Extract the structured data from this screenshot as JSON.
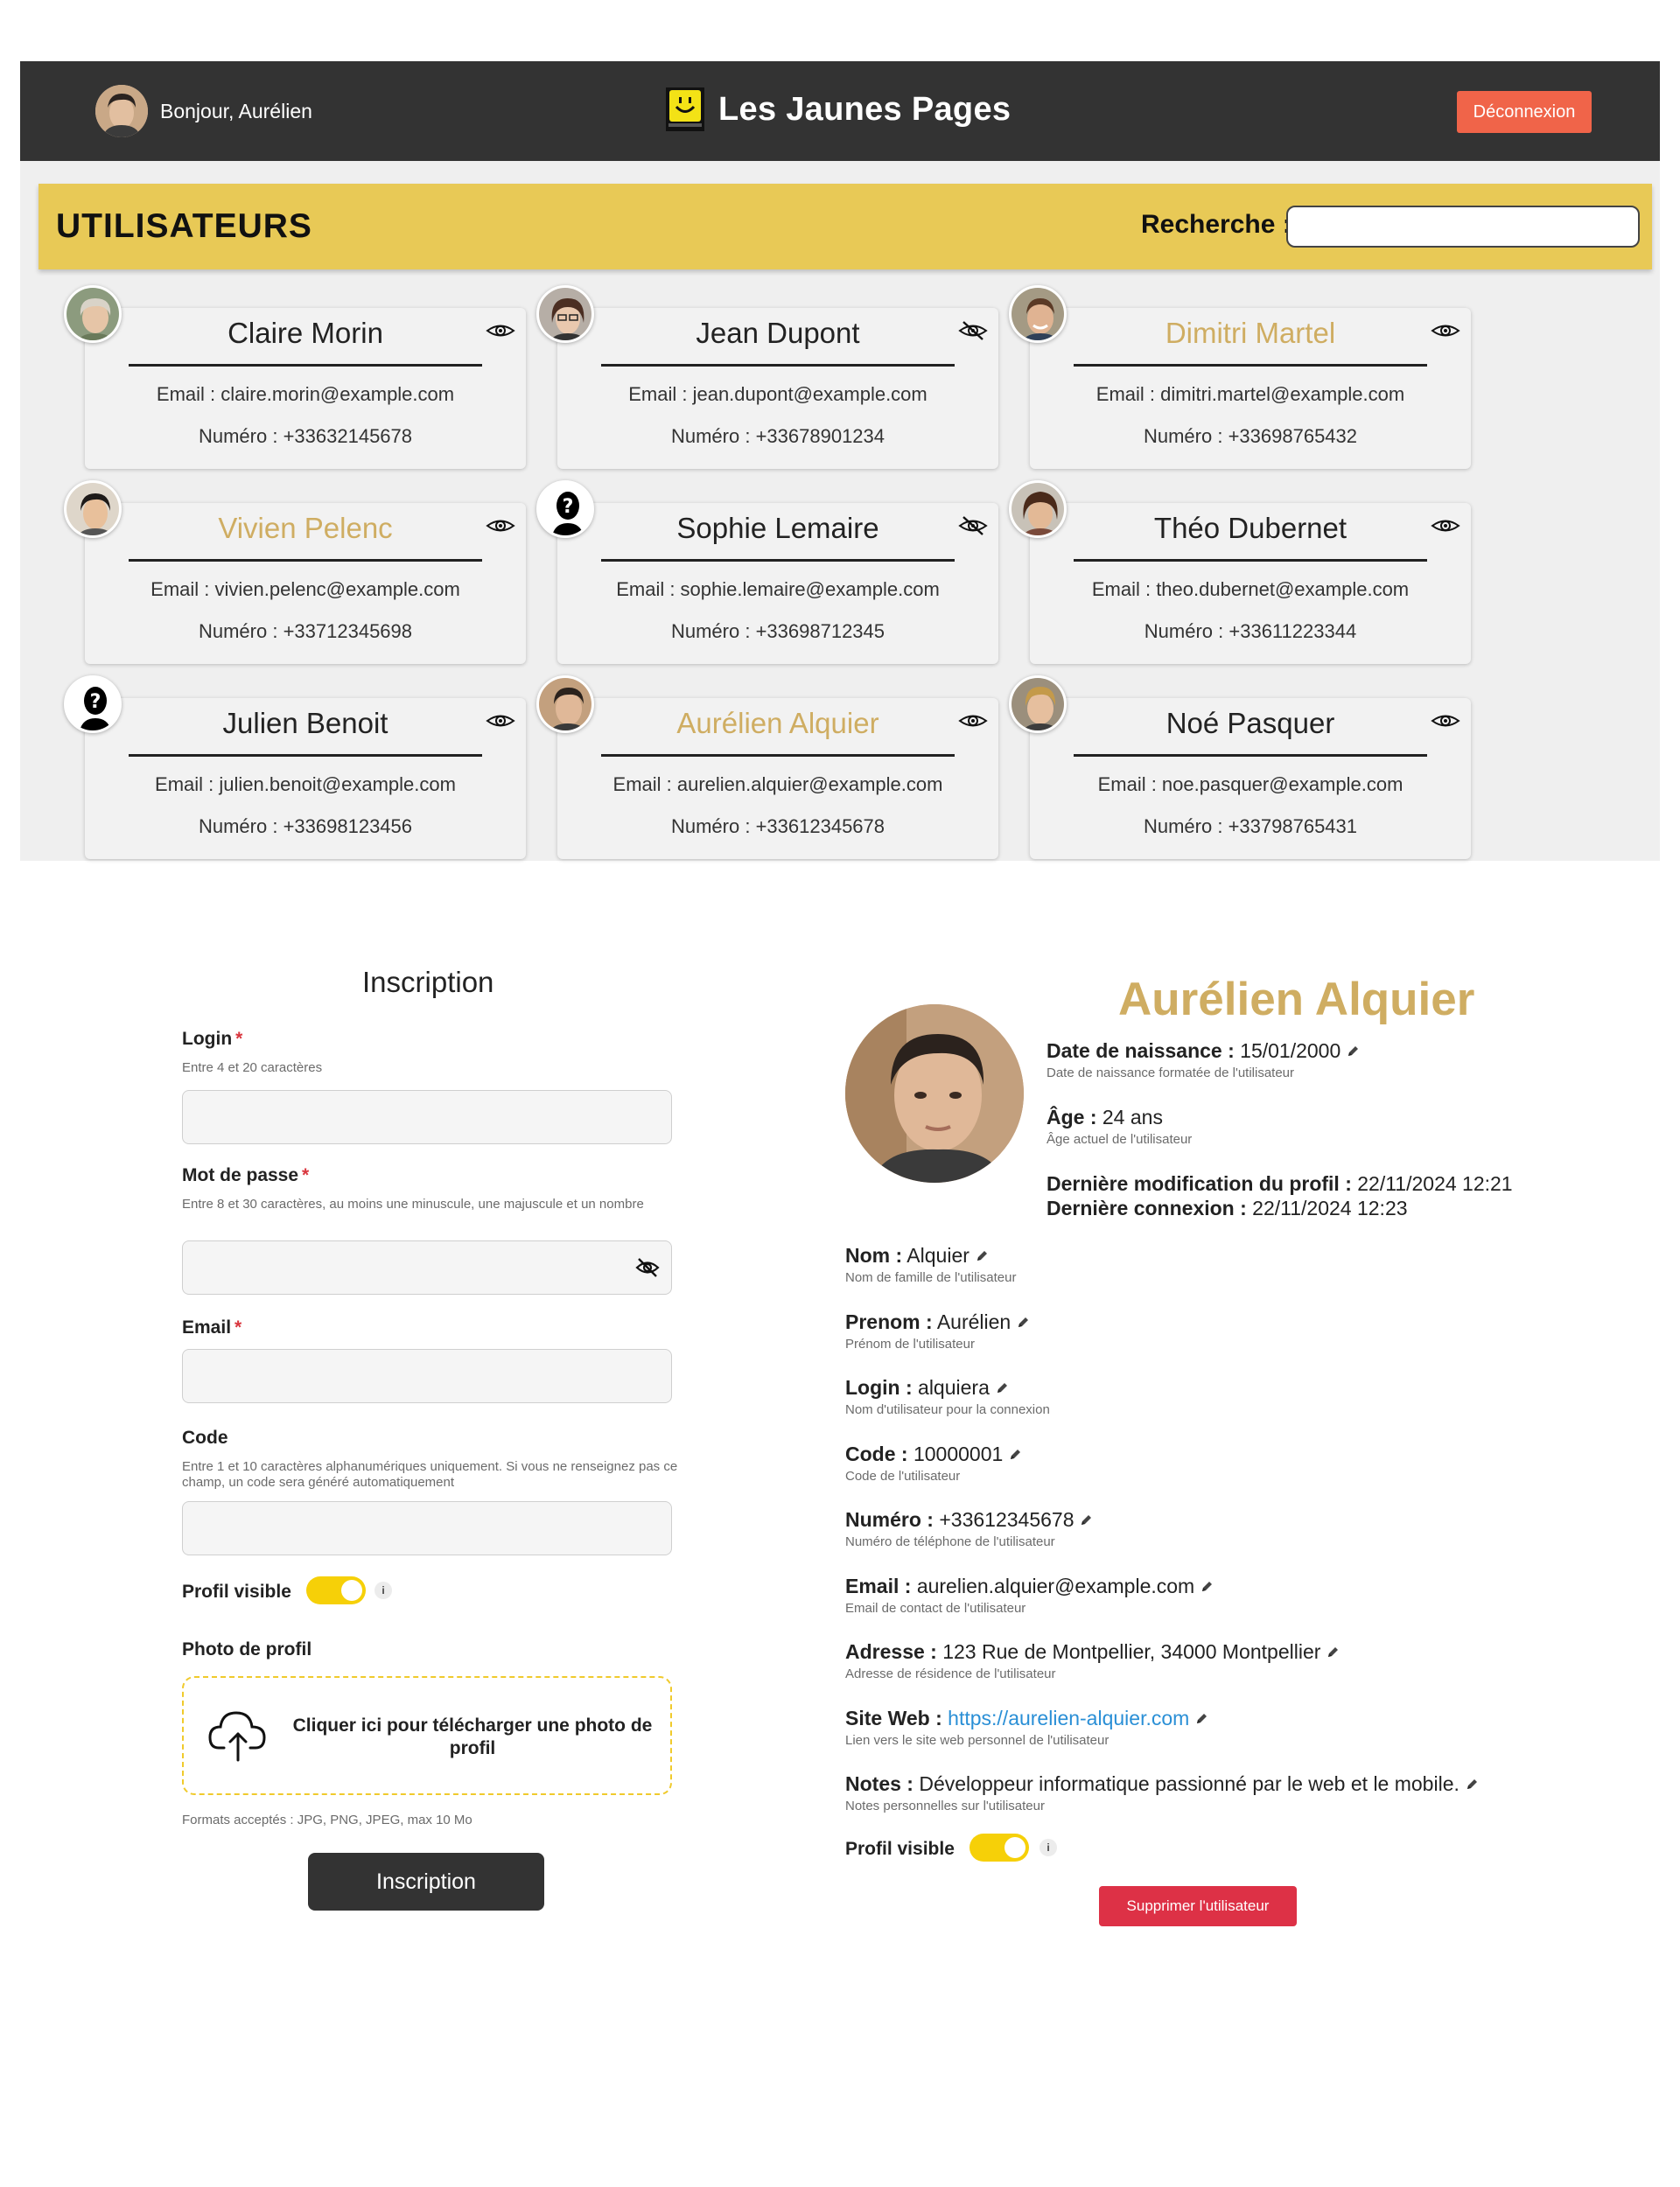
{
  "header": {
    "greeting": "Bonjour, Aurélien",
    "brand": "Les Jaunes Pages",
    "logout_label": "Déconnexion"
  },
  "users_bar": {
    "title": "UTILISATEURS",
    "search_label": "Recherche :",
    "search_value": ""
  },
  "users": [
    {
      "name": "Claire Morin",
      "email": "Email : claire.morin@example.com",
      "phone": "Numéro : +33632145678",
      "visible": true,
      "highlight": false,
      "avatar": "photo-woman-old"
    },
    {
      "name": "Jean Dupont",
      "email": "Email : jean.dupont@example.com",
      "phone": "Numéro : +33678901234",
      "visible": false,
      "highlight": false,
      "avatar": "photo-woman-glasses"
    },
    {
      "name": "Dimitri Martel",
      "email": "Email : dimitri.martel@example.com",
      "phone": "Numéro : +33698765432",
      "visible": true,
      "highlight": true,
      "avatar": "photo-man-smile"
    },
    {
      "name": "Vivien Pelenc",
      "email": "Email : vivien.pelenc@example.com",
      "phone": "Numéro : +33712345698",
      "visible": true,
      "highlight": true,
      "avatar": "photo-man-asian"
    },
    {
      "name": "Sophie Lemaire",
      "email": "Email : sophie.lemaire@example.com",
      "phone": "Numéro : +33698712345",
      "visible": false,
      "highlight": false,
      "avatar": "placeholder-unknown"
    },
    {
      "name": "Théo Dubernet",
      "email": "Email : theo.dubernet@example.com",
      "phone": "Numéro : +33611223344",
      "visible": true,
      "highlight": false,
      "avatar": "photo-woman-curly"
    },
    {
      "name": "Julien Benoit",
      "email": "Email : julien.benoit@example.com",
      "phone": "Numéro : +33698123456",
      "visible": true,
      "highlight": false,
      "avatar": "placeholder-unknown"
    },
    {
      "name": "Aurélien Alquier",
      "email": "Email : aurelien.alquier@example.com",
      "phone": "Numéro : +33612345678",
      "visible": true,
      "highlight": true,
      "avatar": "photo-man-dark"
    },
    {
      "name": "Noé Pasquer",
      "email": "Email : noe.pasquer@example.com",
      "phone": "Numéro : +33798765431",
      "visible": true,
      "highlight": false,
      "avatar": "photo-man-blond"
    }
  ],
  "form": {
    "title": "Inscription",
    "login_label": "Login",
    "login_hint": "Entre 4 et 20 caractères",
    "login_value": "",
    "password_label": "Mot de passe",
    "password_hint": "Entre 8 et 30 caractères, au moins une minuscule, une majuscule et un nombre",
    "password_value": "",
    "email_label": "Email",
    "email_value": "",
    "code_label": "Code",
    "code_hint": "Entre 1 et 10 caractères alphanumériques uniquement. Si vous ne renseignez pas ce champ, un code sera généré automatiquement",
    "code_value": "",
    "required_mark": "*",
    "visible_label": "Profil visible",
    "visible_on": true,
    "info": "i",
    "photo_label": "Photo de profil",
    "upload_text": "Cliquer ici pour télécharger une photo de profil",
    "formats": "Formats acceptés : JPG, PNG, JPEG, max 10 Mo",
    "submit_label": "Inscription"
  },
  "profile": {
    "name": "Aurélien Alquier",
    "birth_label": "Date de naissance :",
    "birth_value": "15/01/2000",
    "birth_hint": "Date de naissance formatée de l'utilisateur",
    "age_label": "Âge :",
    "age_value": "24 ans",
    "age_hint": "Âge actuel de l'utilisateur",
    "modified_label": "Dernière modification du profil :",
    "modified_value": "22/11/2024 12:21",
    "login_time_label": "Dernière connexion :",
    "login_time_value": "22/11/2024 12:23",
    "fields": [
      {
        "label": "Nom :",
        "value": "Alquier",
        "hint": "Nom de famille de l'utilisateur"
      },
      {
        "label": "Prenom :",
        "value": "Aurélien",
        "hint": "Prénom de l'utilisateur"
      },
      {
        "label": "Login :",
        "value": "alquiera",
        "hint": "Nom d'utilisateur pour la connexion"
      },
      {
        "label": "Code :",
        "value": "10000001",
        "hint": "Code de l'utilisateur"
      },
      {
        "label": "Numéro :",
        "value": "+33612345678",
        "hint": "Numéro de téléphone de l'utilisateur"
      },
      {
        "label": "Email :",
        "value": "aurelien.alquier@example.com",
        "hint": "Email de contact de l'utilisateur"
      },
      {
        "label": "Adresse :",
        "value": "123 Rue de Montpellier, 34000 Montpellier",
        "hint": "Adresse de résidence de l'utilisateur"
      },
      {
        "label": "Site Web :",
        "value": "https://aurelien-alquier.com",
        "hint": "Lien vers le site web personnel de l'utilisateur"
      },
      {
        "label": "Notes :",
        "value": "Développeur informatique passionné par le web et le mobile.",
        "hint": "Notes personnelles sur l'utilisateur"
      }
    ],
    "visible_label": "Profil visible",
    "visible_on": true,
    "info": "i",
    "delete_label": "Supprimer l'utilisateur"
  },
  "colors": {
    "accent_yellow": "#e8c956",
    "name_gold": "#cfad62",
    "dark": "#333333",
    "logout": "#f06449",
    "danger": "#dd3146",
    "toggle": "#f6d008",
    "link": "#2a8fd6"
  }
}
